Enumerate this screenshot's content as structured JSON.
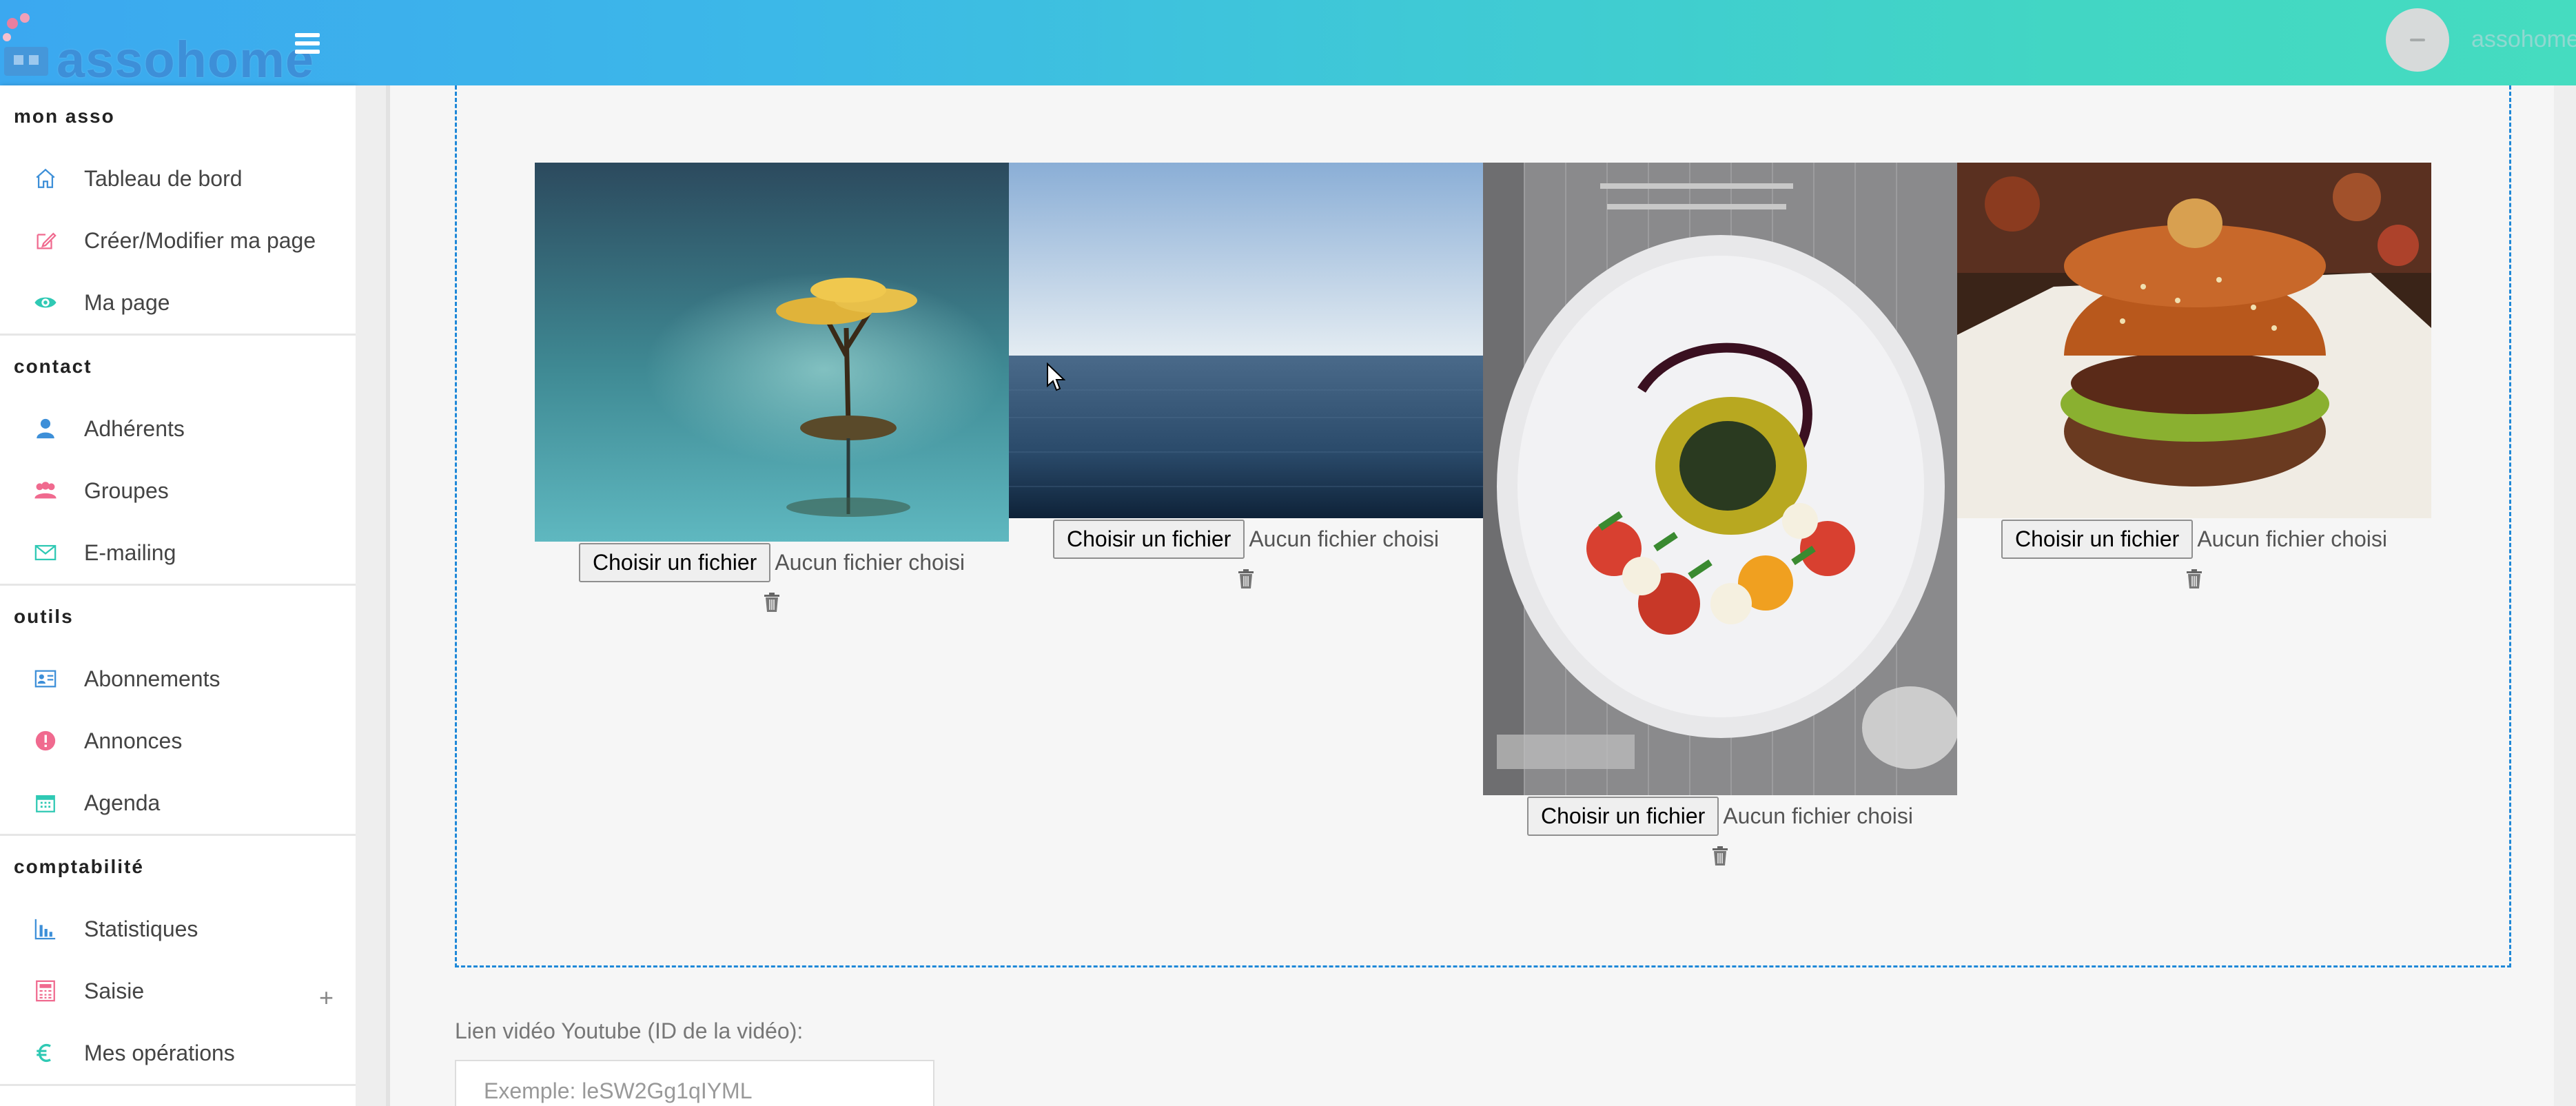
{
  "header": {
    "logo_text": "assohome",
    "user_name": "assohome"
  },
  "sidebar": {
    "sections": [
      {
        "title": "mon asso",
        "items": [
          {
            "label": "Tableau de bord",
            "icon": "home-icon"
          },
          {
            "label": "Créer/Modifier ma page",
            "icon": "edit-icon"
          },
          {
            "label": "Ma page",
            "icon": "eye-icon"
          }
        ]
      },
      {
        "title": "contact",
        "items": [
          {
            "label": "Adhérents",
            "icon": "user-icon"
          },
          {
            "label": "Groupes",
            "icon": "users-icon"
          },
          {
            "label": "E-mailing",
            "icon": "envelope-icon"
          }
        ]
      },
      {
        "title": "outils",
        "items": [
          {
            "label": "Abonnements",
            "icon": "id-card-icon"
          },
          {
            "label": "Annonces",
            "icon": "alert-icon"
          },
          {
            "label": "Agenda",
            "icon": "calendar-icon"
          }
        ]
      },
      {
        "title": "comptabilité",
        "items": [
          {
            "label": "Statistiques",
            "icon": "bar-chart-icon"
          },
          {
            "label": "Saisie",
            "icon": "calculator-icon",
            "expand": "+"
          },
          {
            "label": "Mes opérations",
            "icon": "euro-icon"
          }
        ]
      }
    ]
  },
  "gallery": {
    "upload_button": "Choisir un fichier",
    "no_file_text": "Aucun fichier choisi",
    "images": [
      {
        "subject": "bonsai-tree-on-lake"
      },
      {
        "subject": "calm-sea-horizon"
      },
      {
        "subject": "caprese-salad-plate"
      },
      {
        "subject": "burger"
      }
    ]
  },
  "video": {
    "label": "Lien vidéo Youtube (ID de la vidéo):",
    "placeholder": "Exemple: leSW2Gg1qIYML"
  },
  "colors": {
    "accent": "#1e88d8",
    "header_start": "#3ba8f0",
    "header_end": "#45dcc0",
    "icon_blue": "#3d8fd8",
    "icon_pink": "#f06a8f",
    "icon_teal": "#2fc9b4"
  }
}
